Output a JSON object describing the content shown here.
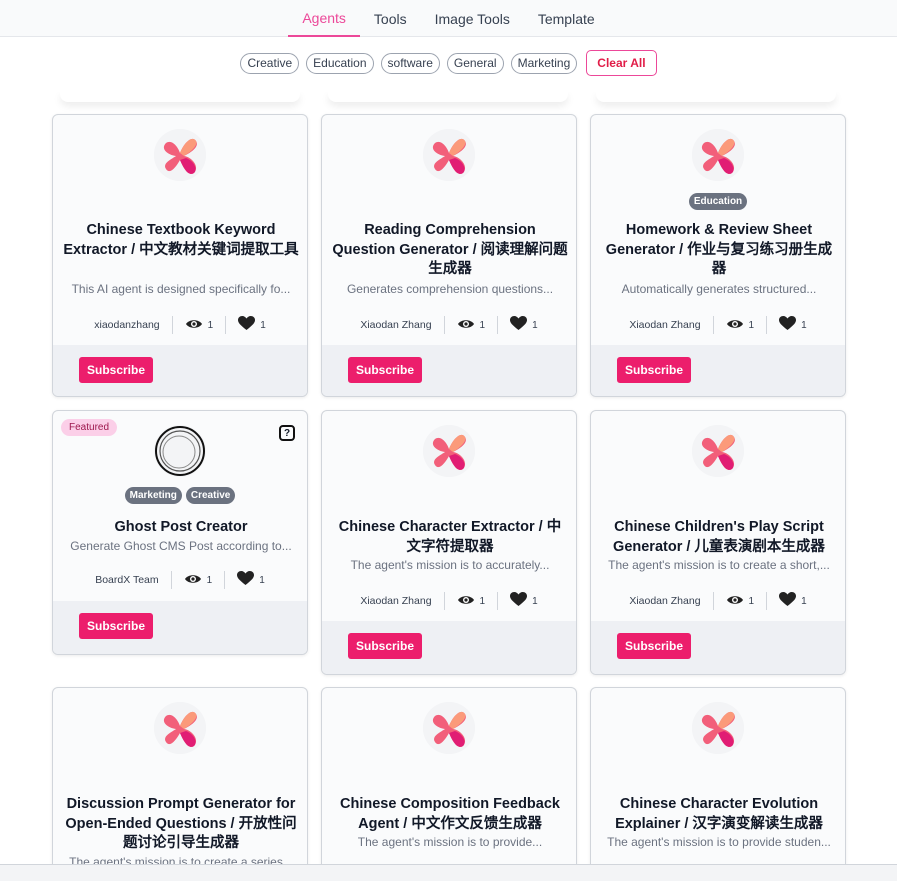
{
  "nav": {
    "tabs": [
      {
        "label": "Agents",
        "active": true
      },
      {
        "label": "Tools"
      },
      {
        "label": "Image Tools"
      },
      {
        "label": "Template"
      }
    ]
  },
  "filters": {
    "chips": [
      "Creative",
      "Education",
      "software",
      "General",
      "Marketing"
    ],
    "clear_label": "Clear All"
  },
  "colors": {
    "accent": "#ec1e6c",
    "badge": "#6b7280",
    "featured_bg": "#fbcfe8"
  },
  "cards": [
    {
      "title": "Chinese Textbook Keyword Extractor / 中文教材关键词提取工具",
      "desc": "This AI agent is designed specifically fo...",
      "author": "xiaodanzhang",
      "views": "1",
      "likes": "1",
      "badges": [],
      "featured": "",
      "icon": "boardx-logo-icon",
      "subscribe": "Subscribe"
    },
    {
      "title": "Reading Comprehension Question Generator / 阅读理解问题生成器",
      "desc": "Generates comprehension questions...",
      "author": "Xiaodan Zhang",
      "views": "1",
      "likes": "1",
      "badges": [],
      "featured": "",
      "icon": "boardx-logo-icon",
      "subscribe": "Subscribe"
    },
    {
      "title": "Homework & Review Sheet Generator / 作业与复习练习册生成器",
      "desc": "Automatically generates structured...",
      "author": "Xiaodan Zhang",
      "views": "1",
      "likes": "1",
      "badges": [
        "Education"
      ],
      "featured": "",
      "icon": "boardx-logo-icon",
      "subscribe": "Subscribe"
    },
    {
      "title": "Ghost Post Creator",
      "desc": "Generate Ghost CMS Post according to...",
      "author": "BoardX Team",
      "views": "1",
      "likes": "1",
      "badges": [
        "Marketing",
        "Creative"
      ],
      "featured": "Featured",
      "icon": "ghost-logo-icon",
      "subscribe": "Subscribe"
    },
    {
      "title": "Chinese Character Extractor / 中文字符提取器",
      "desc": "The agent's mission is to accurately...",
      "author": "Xiaodan Zhang",
      "views": "1",
      "likes": "1",
      "badges": [],
      "featured": "",
      "icon": "boardx-logo-icon",
      "subscribe": "Subscribe"
    },
    {
      "title": "Chinese Children's Play Script Generator / 儿童表演剧本生成器",
      "desc": "The agent's mission is to create a short,...",
      "author": "Xiaodan Zhang",
      "views": "1",
      "likes": "1",
      "badges": [],
      "featured": "",
      "icon": "boardx-logo-icon",
      "subscribe": "Subscribe"
    },
    {
      "title": "Discussion Prompt Generator for Open-Ended Questions / 开放性问题讨论引导生成器",
      "desc": "The agent's mission is to create a series...",
      "author": "",
      "views": "",
      "likes": "",
      "badges": [],
      "featured": "",
      "icon": "boardx-logo-icon",
      "subscribe": ""
    },
    {
      "title": "Chinese Composition Feedback Agent / 中文作文反馈生成器",
      "desc": "The agent's mission is to provide...",
      "author": "",
      "views": "",
      "likes": "",
      "badges": [],
      "featured": "",
      "icon": "boardx-logo-icon",
      "subscribe": ""
    },
    {
      "title": "Chinese Character Evolution Explainer / 汉字演变解读生成器",
      "desc": "The agent's mission is to provide studen...",
      "author": "",
      "views": "",
      "likes": "",
      "badges": [],
      "featured": "",
      "icon": "boardx-logo-icon",
      "subscribe": ""
    }
  ]
}
